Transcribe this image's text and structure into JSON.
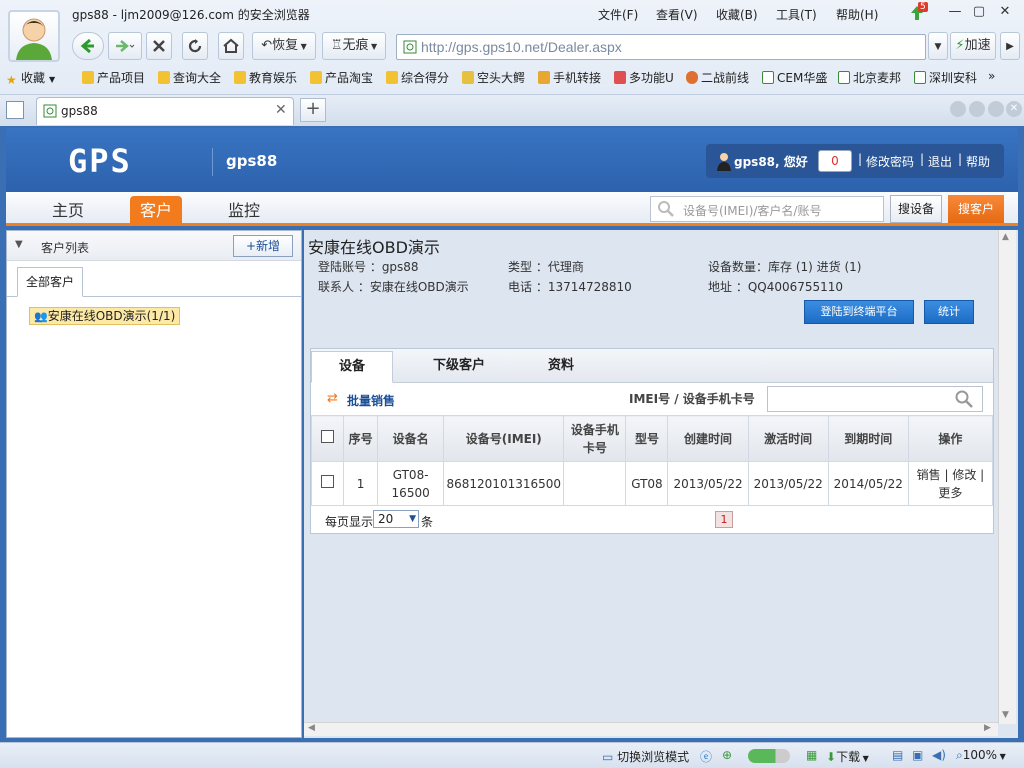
{
  "browser": {
    "window_title": "gps88 - ljm2009@126.com 的安全浏览器",
    "menu": [
      "文件(F)",
      "查看(V)",
      "收藏(B)",
      "工具(T)",
      "帮助(H)"
    ],
    "update_badge": "5",
    "nav": {
      "restore_label": "恢复",
      "incognito_label": "无痕",
      "accelerate_label": "加速"
    },
    "address": "http://gps.gps10.net/Dealer.aspx",
    "bookmarks": [
      "收藏",
      "产品项目",
      "查询大全",
      "教育娱乐",
      "产品淘宝",
      "综合得分",
      "空头大鳄",
      "手机转接",
      "多功能U",
      "二战前线",
      "CEM华盛",
      "北京麦邦",
      "深圳安科"
    ],
    "bookmark_more": "»",
    "tab_title": "gps88",
    "new_tab": "+"
  },
  "app": {
    "logo": "GPS",
    "account_name": "gps88",
    "greeting": "gps88, 您好",
    "message_count": "0",
    "links": [
      "修改密码",
      "退出",
      "帮助"
    ],
    "link_sep": "|",
    "nav_tabs": [
      "主页",
      "客户",
      "监控"
    ],
    "active_tab": 1,
    "search_placeholder": "设备号(IMEI)/客户名/账号",
    "search_device_btn": "搜设备",
    "search_customer_btn": "搜客户"
  },
  "left": {
    "title": "客户列表",
    "add_btn": "+新增",
    "tab": "全部客户",
    "tree_item": "安康在线OBD演示(1/1)"
  },
  "customer": {
    "name": "安康在线OBD演示",
    "login_label": "登陆账号 ：gps88",
    "type_label": "类型 ：代理商",
    "device_count_label": "设备数量：库存 (1) 进货 (1)",
    "contact_label": "联系人 ：安康在线OBD演示",
    "phone_label": "电话 ：13714728810",
    "address_label": "地址 ：QQ4006755110",
    "login_platform_btn": "登陆到终端平台",
    "stats_btn": "统计"
  },
  "grid": {
    "tabs": [
      "设备",
      "下级客户",
      "资料"
    ],
    "batch_sale": "批量销售",
    "imei_label": "IMEI号 / 设备手机卡号",
    "headers": [
      "序号",
      "设备名",
      "设备号(IMEI)",
      "设备手机卡号",
      "型号",
      "创建时间",
      "激活时间",
      "到期时间",
      "操作"
    ],
    "rows": [
      {
        "index": "1",
        "name": "GT08-16500",
        "imei": "868120101316500",
        "sim": "",
        "model": "GT08",
        "created": "2013/05/22",
        "activated": "2013/05/22",
        "expires": "2014/05/22",
        "ops": "销售 | 修改 | 更多"
      }
    ],
    "page_size_prefix": "每页显示",
    "page_size": "20",
    "page_size_suffix": "条",
    "current_page": "1"
  },
  "statusbar": {
    "switch_mode": "切换浏览模式",
    "download": "下载",
    "zoom": "100%"
  }
}
